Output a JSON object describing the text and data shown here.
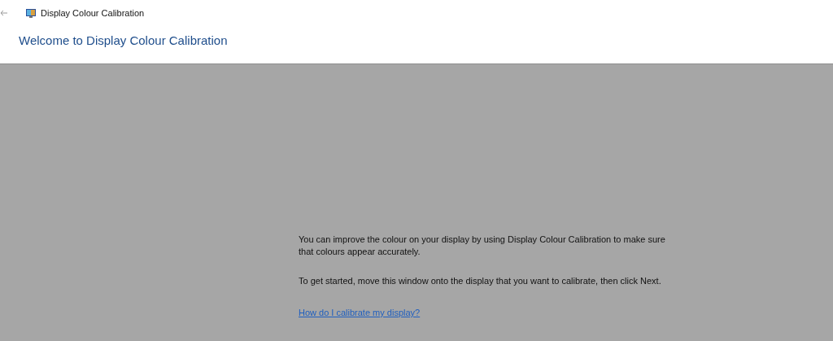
{
  "window": {
    "title": "Display Colour Calibration"
  },
  "heading": "Welcome to Display Colour Calibration",
  "paragraphs": [
    "You can improve the colour on your display by using Display Colour Calibration to make sure that colours appear accurately.",
    "To get started, move this window onto the display that you want to calibrate, then click Next."
  ],
  "help_link": "How do I calibrate my display?"
}
